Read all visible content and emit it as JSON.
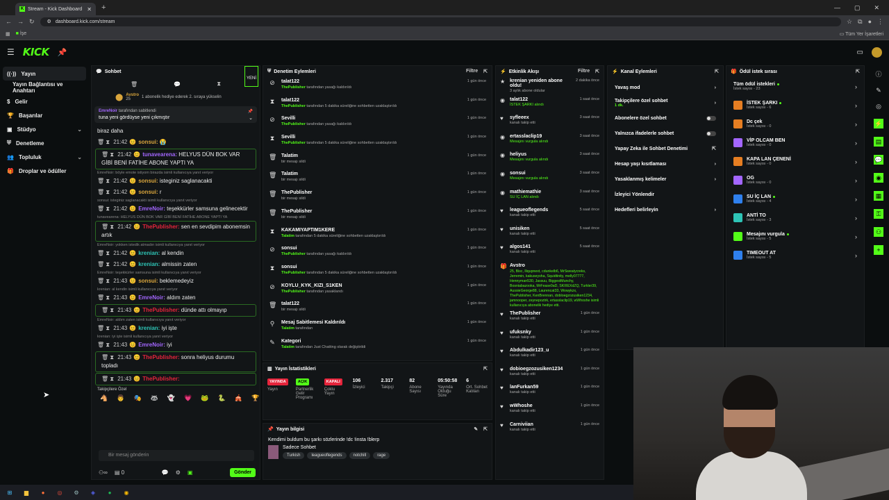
{
  "browser": {
    "tab_title": "Stream - Kick Dashboard",
    "url": "dashboard.kick.com/stream",
    "bookmark": "İşe",
    "all_bookmarks": "Tüm Yer İşaretleri",
    "new_tab": "+",
    "win_min": "—",
    "win_max": "▢",
    "win_close": "✕"
  },
  "top": {
    "logo": "KICK"
  },
  "sidenav": {
    "items": [
      {
        "label": "Yayın"
      },
      {
        "label": "Yayın Bağlantısı ve Anahtarı"
      },
      {
        "label": "Gelir"
      },
      {
        "label": "Başarılar"
      },
      {
        "label": "Stüdyo"
      },
      {
        "label": "Denetleme"
      },
      {
        "label": "Topluluk"
      },
      {
        "label": "Droplar ve ödüller"
      }
    ]
  },
  "chat": {
    "title": "Sohbet",
    "new_label": "YENİ",
    "gift_user": "Avstro",
    "gift_count": "25",
    "gift_text": "1 abonelik hediye ederek 2. sıraya yükselin",
    "pinned_by": "EmreNoir",
    "pinned_label": "tarafından sabitlendi",
    "pinned_msg": "tuna yeni gördüyse yeni çıkmıştır",
    "messages": [
      {
        "reply": "",
        "time": "",
        "user": "",
        "color": "#ffffff",
        "text": "biraz daha",
        "hl": false
      },
      {
        "reply": "",
        "time": "21:42",
        "user": "sonsui:",
        "color": "#d9a53c",
        "text": "😭",
        "hl": false
      },
      {
        "reply": "",
        "time": "21:42",
        "user": "tunavearena:",
        "color": "#a366ff",
        "text": "HELYUS DÜN BOK VAR GİBİ BENİ FATİHE ABONE YAPTI YA",
        "hl": true
      },
      {
        "reply": "EmreNoir: böyle emote istiyom birazda isimli kullanıcıya yanıt veriyor",
        "time": "21:42",
        "user": "sonsui:",
        "color": "#d9a53c",
        "text": "isteginiz saglanacakti",
        "hl": false
      },
      {
        "reply": "",
        "time": "21:42",
        "user": "sonsui:",
        "color": "#d9a53c",
        "text": "r",
        "hl": false
      },
      {
        "reply": "sonsui: isteginiz saglanacakti isimli kullanıcıya yanıt veriyor",
        "time": "21:42",
        "user": "EmreNoir:",
        "color": "#a366ff",
        "text": "teşekkürler samsuna gelinecektir",
        "hl": false
      },
      {
        "reply": "tunavearena: HELYUS DÜN BOK VAR GİBİ BENİ FATİHE ABONE YAPTI YA",
        "time": "21:42",
        "user": "ThePublisher:",
        "color": "#e5243b",
        "text": "sen en sevdipim abonemsin artık",
        "hl": true
      },
      {
        "reply": "EmreNoir: yokken istedik atmadın isimli kullanıcıya yanıt veriyor",
        "time": "21:42",
        "user": "krenian:",
        "color": "#2ec4b6",
        "text": "al kendin",
        "hl": false
      },
      {
        "reply": "",
        "time": "21:42",
        "user": "krenian:",
        "color": "#2ec4b6",
        "text": "almissin zaten",
        "hl": false
      },
      {
        "reply": "EmreNoir: teşekkürler samsuna isimli kullanıcıya yanıt veriyor",
        "time": "21:43",
        "user": "sonsui:",
        "color": "#d9a53c",
        "text": "beklemedeyiz",
        "hl": false
      },
      {
        "reply": "krenian: al kendin isimli kullanıcıya yanıt veriyor",
        "time": "21:43",
        "user": "EmreNoir:",
        "color": "#a366ff",
        "text": "aldım zaten",
        "hl": false
      },
      {
        "reply": "",
        "time": "21:43",
        "user": "ThePublisher:",
        "color": "#e5243b",
        "text": "dünde attı olmayıp",
        "hl": true
      },
      {
        "reply": "EmreNoir: aldım zaten isimli kullanıcıya yanıt veriyor",
        "time": "21:43",
        "user": "krenian:",
        "color": "#2ec4b6",
        "text": "iyi işte",
        "hl": false
      },
      {
        "reply": "krenian: iyi işte isimli kullanıcıya yanıt veriyor",
        "time": "21:43",
        "user": "EmreNoir:",
        "color": "#a366ff",
        "text": "iyi",
        "hl": false
      },
      {
        "reply": "",
        "time": "21:43",
        "user": "ThePublisher:",
        "color": "#e5243b",
        "text": "sonra heliyus durumu topladı",
        "hl": true
      },
      {
        "reply": "",
        "time": "21:43",
        "user": "ThePublisher:",
        "color": "#e5243b",
        "text": "",
        "hl": true
      }
    ],
    "emote_label": "Takipçilere Özel",
    "emotes": [
      "🐴",
      "👨",
      "🎭",
      "🦝",
      "👻",
      "💗",
      "🐸",
      "🐍",
      "🎪",
      "🏆"
    ],
    "input_placeholder": "Bir mesaj gönderin",
    "footer_count": "0",
    "send_label": "Gönder"
  },
  "moderation": {
    "title": "Denetim Eylemleri",
    "filter": "Filtre",
    "events": [
      {
        "icon": "⊘",
        "name": "talat122",
        "by": "ThePublisher",
        "desc": "tarafından yasağı kaldırıldı",
        "time": "1 gün önce"
      },
      {
        "icon": "⧗",
        "name": "talat122",
        "by": "ThePublisher",
        "desc": "tarafından 5 dakika süreliğine sohbetten uzaklaştırıldı",
        "time": "1 gün önce"
      },
      {
        "icon": "⊘",
        "name": "Sevilli",
        "by": "ThePublisher",
        "desc": "tarafından yasağı kaldırıldı",
        "time": "1 gün önce"
      },
      {
        "icon": "⧗",
        "name": "Sevilli",
        "by": "ThePublisher",
        "desc": "tarafından 5 dakika süreliğine sohbetten uzaklaştırıldı",
        "time": "1 gün önce"
      },
      {
        "icon": "🗑",
        "name": "Talatim",
        "by": "",
        "desc": "bir mesajı sildi",
        "time": "1 gün önce"
      },
      {
        "icon": "🗑",
        "name": "Talatim",
        "by": "",
        "desc": "bir mesajı sildi",
        "time": "1 gün önce"
      },
      {
        "icon": "🗑",
        "name": "ThePublisher",
        "by": "",
        "desc": "bir mesajı sildi",
        "time": "1 gün önce"
      },
      {
        "icon": "🗑",
        "name": "ThePublisher",
        "by": "",
        "desc": "bir mesajı sildi",
        "time": "1 gün önce"
      },
      {
        "icon": "⧗",
        "name": "KAKAMIYAPTIM1KERE",
        "by": "Talatim",
        "desc": "tarafından 5 dakika süreliğine sohbetten uzaklaştırıldı",
        "time": "1 gün önce"
      },
      {
        "icon": "⊘",
        "name": "sonsui",
        "by": "ThePublisher",
        "desc": "tarafından yasağı kaldırıldı",
        "time": "1 gün önce"
      },
      {
        "icon": "⧗",
        "name": "sonsui",
        "by": "ThePublisher",
        "desc": "tarafından 5 dakika süreliğine sohbetten uzaklaştırıldı",
        "time": "1 gün önce"
      },
      {
        "icon": "⊘",
        "name": "KOYLU_KYK_KIZI_S1KEN",
        "by": "ThePublisher",
        "desc": "tarafından yasaklandı",
        "time": "1 gün önce"
      },
      {
        "icon": "🗑",
        "name": "talat122",
        "by": "",
        "desc": "bir mesajı sildi",
        "time": "1 gün önce"
      },
      {
        "icon": "⚲",
        "name": "Mesaj Sabitlemesi Kaldırıldı",
        "by": "Talatim",
        "desc": "tarafından",
        "time": "1 gün önce"
      },
      {
        "icon": "✎",
        "name": "Kategori",
        "by": "Talatim",
        "desc": "tarafından Just Chatting olarak değiştirildi",
        "time": "1 gün önce"
      }
    ]
  },
  "stats": {
    "title": "Yayın İstatistikleri",
    "items": [
      {
        "pill": "YAYINDA",
        "pill_class": "red",
        "label": "Yayın"
      },
      {
        "pill": "AÇIK",
        "pill_class": "grn",
        "label": "Partnerlik Gelir Programı"
      },
      {
        "pill": "KAPALI",
        "pill_class": "red",
        "label": "Çoklu Yayın"
      },
      {
        "value": "106",
        "label": "İzleyici"
      },
      {
        "value": "2.317",
        "label": "Takipçi"
      },
      {
        "value": "82",
        "label": "Abone Sayısı"
      },
      {
        "value": "05:50:58",
        "label": "Yayında Olduğu Süre"
      },
      {
        "value": "6",
        "label": "Ort. Sohbet Katılan"
      }
    ]
  },
  "info": {
    "title": "Yayın bilgisi",
    "stream_title": "Kendimi buldum bu şarkı sözlerinde !dc !insta !blerp",
    "mode": "Sadece Sohbet",
    "tags": [
      "Turkish",
      "leagueoflegends",
      "notchill",
      "rage"
    ]
  },
  "activity": {
    "title": "Etkinlik Akışı",
    "filter": "Filtre",
    "events": [
      {
        "icon": "★",
        "name": "krenian yeniden abone oldu!",
        "desc": "3 aylık abone oldular",
        "green": false,
        "time": "2 dakika önce"
      },
      {
        "icon": "◉",
        "name": "talat122",
        "desc": "İSTEK ŞARKI alındı",
        "green": true,
        "time": "1 saat önce"
      },
      {
        "icon": "♥",
        "name": "syfleeex",
        "desc": "kanalı takip etti",
        "green": false,
        "time": "3 saat önce"
      },
      {
        "icon": "◉",
        "name": "ertasslaclip19",
        "desc": "Mesajını vurgula alındı",
        "green": true,
        "time": "3 saat önce"
      },
      {
        "icon": "◉",
        "name": "heliyus",
        "desc": "Mesajını vurgula alındı",
        "green": true,
        "time": "3 saat önce"
      },
      {
        "icon": "◉",
        "name": "sonsui",
        "desc": "Mesajını vurgula alındı",
        "green": true,
        "time": "3 saat önce"
      },
      {
        "icon": "◉",
        "name": "mathiemathie",
        "desc": "SU İÇ LAN alındı",
        "green": true,
        "time": "3 saat önce"
      },
      {
        "icon": "♥",
        "name": "leagueoflegends",
        "desc": "kanalı takip etti",
        "green": false,
        "time": "5 saat önce"
      },
      {
        "icon": "♥",
        "name": "unisiken",
        "desc": "kanalı takip etti",
        "green": false,
        "time": "5 saat önce"
      },
      {
        "icon": "♥",
        "name": "algos141",
        "desc": "kanalı takip etti",
        "green": false,
        "time": "5 saat önce"
      }
    ],
    "gift_name": "Avstro",
    "gift_list": "25, Bisc, lliqupnext, cdunkelb6, MrSweatycreks, Jerremin, kakuseysha, Squidtinity, melly07777, Hennyman530, Jassuu, BiggestMunchy, Bosniabazooka, MrFease0aD, SKIIIEXdZQ, Turkler39, AussieGeorge88, Laurencat33, Wowykzx, ThePublisher, KenBrennan, dobloegzozusiken1234, jamnooper, zeynepoztrk, ertasslaclip19, wWhoshe isimli kullanıcıya abonelik hediye etti.",
    "events2": [
      {
        "icon": "♥",
        "name": "ThePublisher",
        "desc": "kanalı takip etti",
        "time": "1 gün önce"
      },
      {
        "icon": "♥",
        "name": "ufuksnky",
        "desc": "kanalı takip etti",
        "time": "1 gün önce"
      },
      {
        "icon": "♥",
        "name": "Abdulkadir123_u",
        "desc": "kanalı takip etti",
        "time": "1 gün önce"
      },
      {
        "icon": "♥",
        "name": "dobioegzozusiken1234",
        "desc": "kanalı takip etti",
        "time": "1 gün önce"
      },
      {
        "icon": "♥",
        "name": "lanFurkan59",
        "desc": "kanalı takip etti",
        "time": "1 gün önce"
      },
      {
        "icon": "♥",
        "name": "wWhoshe",
        "desc": "kanalı takip etti",
        "time": "1 gün önce"
      },
      {
        "icon": "♥",
        "name": "Carniviian",
        "desc": "kanalı takip etti",
        "time": "1 gün önce"
      }
    ]
  },
  "channel": {
    "title": "Kanal Eylemleri",
    "items": [
      {
        "label": "Yavaş mod",
        "sub": "",
        "kind": "arrow"
      },
      {
        "label": "Takipçilere özel sohbet",
        "sub": "1 dk.",
        "kind": "arrow"
      },
      {
        "label": "Abonelere özel sohbet",
        "sub": "",
        "kind": "toggle"
      },
      {
        "label": "Yalnızca ifadelerle sohbet",
        "sub": "",
        "kind": "toggle"
      },
      {
        "label": "Yapay Zeka ile Sohbet Denetimi",
        "sub": "",
        "kind": "ext"
      },
      {
        "label": "Hesap yaşı kısıtlaması",
        "sub": "",
        "kind": "arrow"
      },
      {
        "label": "Yasaklanmış kelimeler",
        "sub": "",
        "kind": "arrow"
      },
      {
        "label": "İzleyici Yönlendir",
        "sub": "",
        "kind": "none"
      },
      {
        "label": "Hedefleri belirleyin",
        "sub": "",
        "kind": "arrow"
      }
    ]
  },
  "rewards": {
    "title": "Ödül istek sırası",
    "all_label": "Tüm ödül istekleri",
    "all_count": "İstek sayısı - 23",
    "items": [
      {
        "name": "İSTEK ŞARKI",
        "count": "İstek sayısı - 6",
        "color": "#e67e22",
        "dot": true
      },
      {
        "name": "Dc çek",
        "count": "İstek sayısı - 0",
        "color": "#e67e22",
        "dot": false
      },
      {
        "name": "VİP OLCAM BEN",
        "count": "İstek sayısı - 0",
        "color": "#a366ff",
        "dot": false
      },
      {
        "name": "KAPA LAN ÇENENİ",
        "count": "İstek sayısı - 0",
        "color": "#e67e22",
        "dot": false
      },
      {
        "name": "OG",
        "count": "İstek sayısı - 0",
        "color": "#a366ff",
        "dot": false
      },
      {
        "name": "SU İÇ LAN",
        "count": "İstek sayısı - 4",
        "color": "#2f80ed",
        "dot": true
      },
      {
        "name": "ANTİ TO",
        "count": "İstek sayısı - 3",
        "color": "#2ec4b6",
        "dot": false
      },
      {
        "name": "Mesajını vurgula",
        "count": "İstek sayısı - 5",
        "color": "#53fc18",
        "dot": true
      },
      {
        "name": "TIMEOUT AT",
        "count": "İstek sayısı - 5",
        "color": "#2f80ed",
        "dot": false
      }
    ]
  }
}
